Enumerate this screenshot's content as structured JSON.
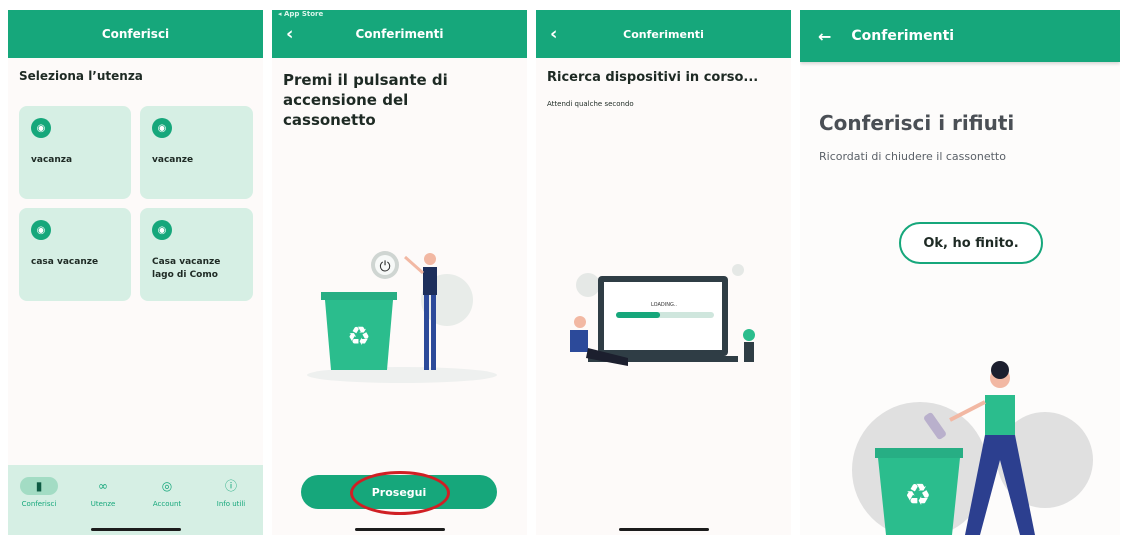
{
  "screen1": {
    "header_title": "Conferisci",
    "section_title": "Seleziona l’utenza",
    "tiles": [
      {
        "label": "vacanza"
      },
      {
        "label": "vacanze"
      },
      {
        "label": "casa vacanze"
      },
      {
        "label": "Casa vacanze lago di Como"
      }
    ],
    "nav": [
      {
        "label": "Conferisci",
        "icon": "trash-icon"
      },
      {
        "label": "Utenze",
        "icon": "users-icon"
      },
      {
        "label": "Account",
        "icon": "account-icon"
      },
      {
        "label": "Info utili",
        "icon": "info-icon"
      }
    ]
  },
  "screen2": {
    "status_text": "◂ App Store",
    "header_title": "Conferimenti",
    "heading": "Premi il pulsante di accensione del cassonetto",
    "button_label": "Prosegui"
  },
  "screen3": {
    "header_title": "Conferimenti",
    "heading": "Ricerca dispositivi in corso...",
    "subtext": "Attendi qualche secondo",
    "loading_text": "LOADING..",
    "loading_progress": 0.45
  },
  "screen4": {
    "header_title": "Conferimenti",
    "heading": "Conferisci i rifiuti",
    "subtext": "Ricordati di chiudere il cassonetto",
    "button_label": "Ok, ho finito."
  },
  "colors": {
    "brand": "#16a77b",
    "tile": "#d6efe4",
    "highlight": "#d01f24"
  }
}
